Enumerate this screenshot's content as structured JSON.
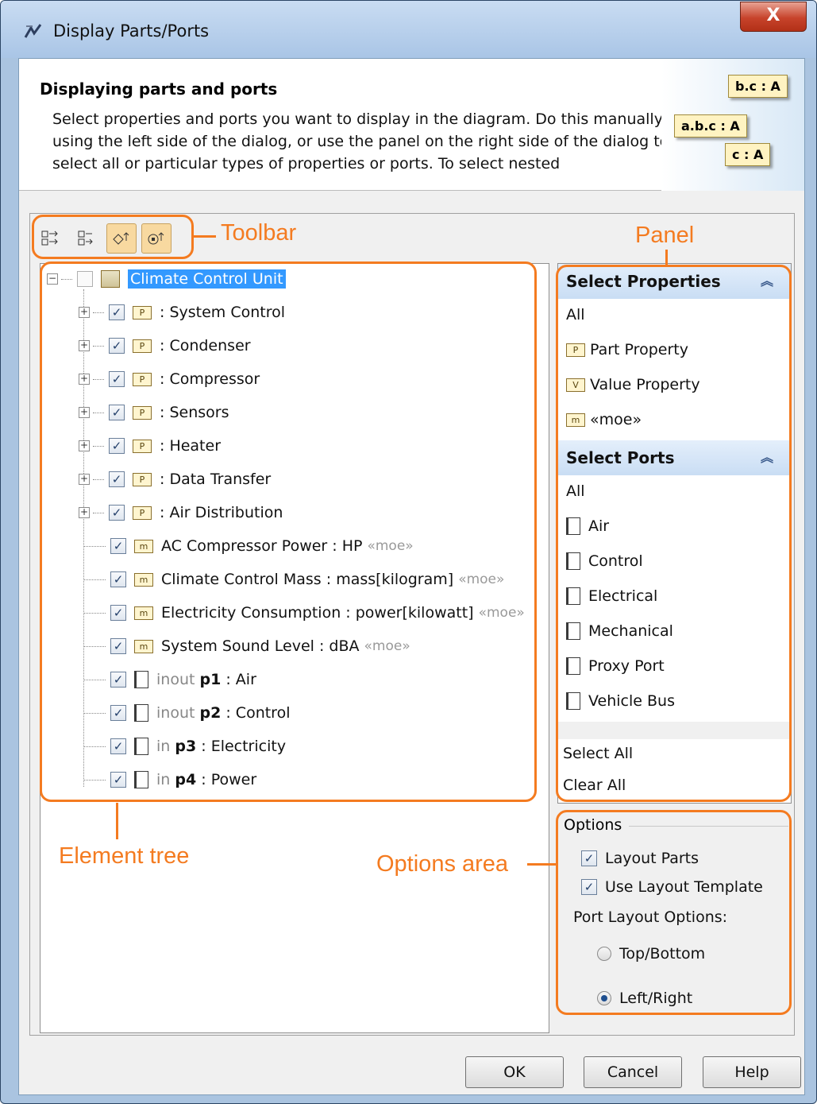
{
  "window": {
    "title": "Display Parts/Ports",
    "close_label": "X"
  },
  "header": {
    "title": "Displaying parts and ports",
    "description": "Select properties and ports you want to display in the diagram. Do this manually using the left side of the dialog, or use the panel on the right side of the dialog to select all or particular types of properties or ports. To select nested",
    "art_labels": [
      "b.c : A",
      "a.b.c : A",
      "c : A"
    ]
  },
  "toolbar": {
    "buttons": [
      "expand-all",
      "collapse-all",
      "select-parts",
      "select-ports"
    ]
  },
  "tree": {
    "root": "Climate Control Unit",
    "parts": [
      ": System Control",
      ": Condenser",
      ": Compressor",
      ": Sensors",
      ": Heater",
      ": Data Transfer",
      ": Air Distribution"
    ],
    "values": [
      {
        "name": "AC Compressor Power",
        "type": "HP",
        "stereo": "«moe»"
      },
      {
        "name": "Climate Control Mass",
        "type": "mass[kilogram]",
        "stereo": "«moe»"
      },
      {
        "name": "Electricity Consumption",
        "type": "power[kilowatt]",
        "stereo": "«moe»"
      },
      {
        "name": "System Sound Level",
        "type": "dBA",
        "stereo": "«moe»"
      }
    ],
    "ports": [
      {
        "dir": "inout",
        "name": "p1",
        "type": "Air"
      },
      {
        "dir": "inout",
        "name": "p2",
        "type": "Control"
      },
      {
        "dir": "in",
        "name": "p3",
        "type": "Electricity"
      },
      {
        "dir": "in",
        "name": "p4",
        "type": "Power"
      }
    ]
  },
  "panel": {
    "properties_title": "Select Properties",
    "properties": [
      "All",
      "Part Property",
      "Value Property",
      "«moe»"
    ],
    "ports_title": "Select Ports",
    "ports": [
      "All",
      "Air",
      "Control",
      "Electrical",
      "Mechanical",
      "Proxy Port",
      "Vehicle Bus"
    ],
    "select_all": "Select All",
    "clear_all": "Clear All"
  },
  "options": {
    "legend": "Options",
    "layout_parts": "Layout Parts",
    "use_layout_template": "Use Layout Template",
    "port_layout_label": "Port Layout Options:",
    "top_bottom": "Top/Bottom",
    "left_right": "Left/Right",
    "selected_layout": "Left/Right"
  },
  "buttons": {
    "ok": "OK",
    "cancel": "Cancel",
    "help": "Help"
  },
  "annotations": {
    "toolbar": "Toolbar",
    "panel": "Panel",
    "element_tree": "Element tree",
    "options_area": "Options area"
  },
  "colors": {
    "annotation": "#f47b20",
    "selection": "#3399ff",
    "section_header": "#c9ddf4"
  }
}
